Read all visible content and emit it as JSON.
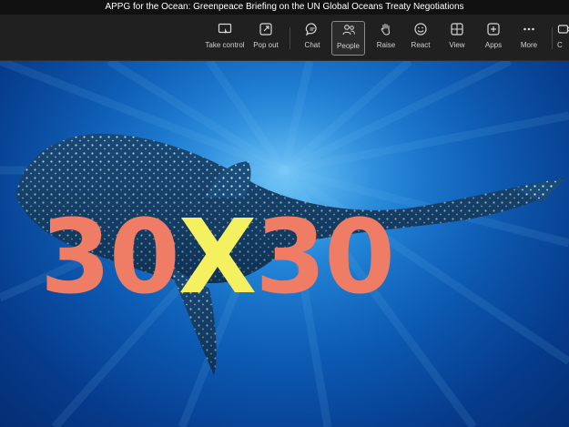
{
  "window": {
    "title": "APPG for the Ocean: Greenpeace Briefing on the UN Global Oceans Treaty Negotiations"
  },
  "toolbar": {
    "items": [
      {
        "label": "Take control",
        "icon": "take-control-icon"
      },
      {
        "label": "Pop out",
        "icon": "pop-out-icon"
      },
      {
        "label": "Chat",
        "icon": "chat-icon"
      },
      {
        "label": "People",
        "icon": "people-icon",
        "active": true
      },
      {
        "label": "Raise",
        "icon": "raise-hand-icon"
      },
      {
        "label": "React",
        "icon": "react-icon"
      },
      {
        "label": "View",
        "icon": "view-icon"
      },
      {
        "label": "Apps",
        "icon": "apps-icon"
      },
      {
        "label": "More",
        "icon": "more-icon"
      },
      {
        "label": "C",
        "icon": "camera-icon"
      }
    ]
  },
  "slide": {
    "part1": "30",
    "part2": "X",
    "part3": "30",
    "colors": {
      "numbers": "#ef7c64",
      "x": "#f4f060",
      "water": "#0c5cb6"
    }
  }
}
